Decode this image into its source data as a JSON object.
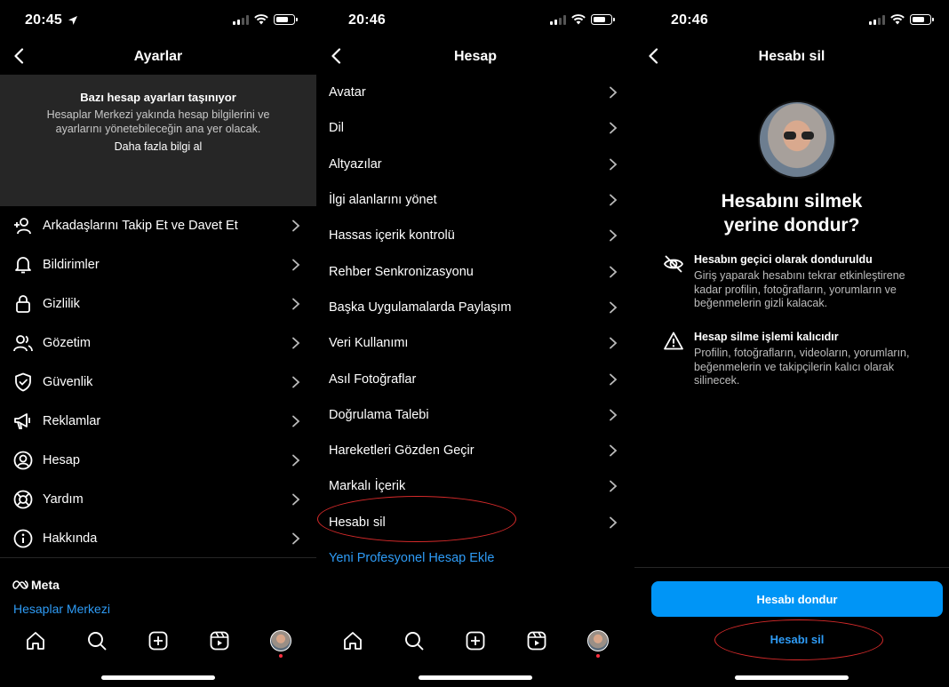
{
  "colors": {
    "background": "#000000",
    "banner": "#262626",
    "accent_blue": "#0095f6",
    "link_blue": "#2e9bf5",
    "annotation_red": "#d62a2a"
  },
  "screen1": {
    "status_time": "20:45",
    "title": "Ayarlar",
    "banner": {
      "title": "Bazı hesap ayarları taşınıyor",
      "text": "Hesaplar Merkezi yakında hesap bilgilerini ve ayarlarını yönetebileceğin ana yer olacak.",
      "link": "Daha fazla bilgi al"
    },
    "items": [
      {
        "label": "Arkadaşlarını Takip Et ve Davet Et",
        "icon": "add-person-icon"
      },
      {
        "label": "Bildirimler",
        "icon": "bell-icon"
      },
      {
        "label": "Gizlilik",
        "icon": "lock-icon"
      },
      {
        "label": "Gözetim",
        "icon": "people-icon"
      },
      {
        "label": "Güvenlik",
        "icon": "shield-icon"
      },
      {
        "label": "Reklamlar",
        "icon": "megaphone-icon"
      },
      {
        "label": "Hesap",
        "icon": "account-icon"
      },
      {
        "label": "Yardım",
        "icon": "lifebuoy-icon"
      },
      {
        "label": "Hakkında",
        "icon": "info-icon"
      }
    ],
    "meta_brand": "Meta",
    "accounts_center": "Hesaplar Merkezi"
  },
  "screen2": {
    "status_time": "20:46",
    "title": "Hesap",
    "items": [
      {
        "label": "Avatar"
      },
      {
        "label": "Dil"
      },
      {
        "label": "Altyazılar"
      },
      {
        "label": "İlgi alanlarını yönet"
      },
      {
        "label": "Hassas içerik kontrolü"
      },
      {
        "label": "Rehber Senkronizasyonu"
      },
      {
        "label": "Başka Uygulamalarda Paylaşım"
      },
      {
        "label": "Veri Kullanımı"
      },
      {
        "label": "Asıl Fotoğraflar"
      },
      {
        "label": "Doğrulama Talebi"
      },
      {
        "label": "Hareketleri Gözden Geçir"
      },
      {
        "label": "Markalı İçerik"
      },
      {
        "label": "Hesabı sil"
      }
    ],
    "add_professional": "Yeni Profesyonel Hesap Ekle"
  },
  "screen3": {
    "status_time": "20:46",
    "title": "Hesabı sil",
    "headline_line1": "Hesabını silmek",
    "headline_line2": "yerine dondur?",
    "info": [
      {
        "title": "Hesabın geçici olarak donduruldu",
        "text": "Giriş yaparak hesabını tekrar etkinleştirene kadar profilin, fotoğrafların, yorumların ve beğenmelerin gizli kalacak.",
        "icon": "eye-off-icon"
      },
      {
        "title": "Hesap silme işlemi kalıcıdır",
        "text": "Profilin, fotoğrafların, videoların, yorumların, beğenmelerin ve takipçilerin kalıcı olarak silinecek.",
        "icon": "warning-icon"
      }
    ],
    "primary_button": "Hesabı dondur",
    "secondary_button": "Hesabı sil"
  },
  "tabbar": [
    "home-icon",
    "search-icon",
    "create-icon",
    "reels-icon",
    "profile-avatar"
  ]
}
